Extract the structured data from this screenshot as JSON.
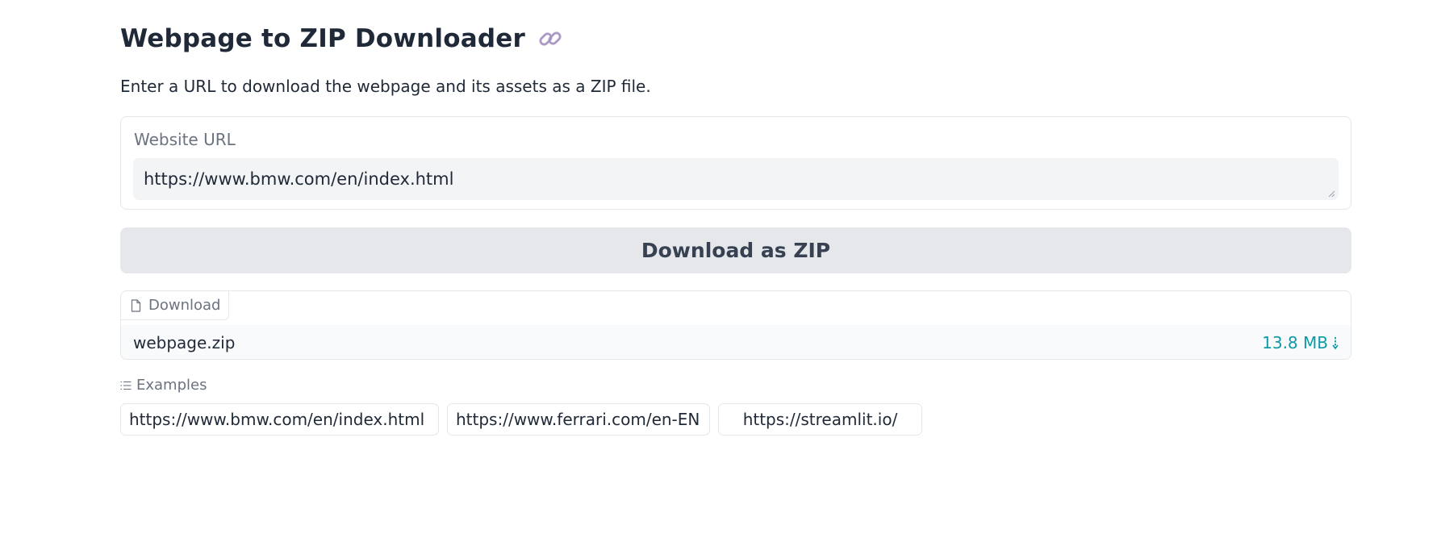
{
  "header": {
    "title": "Webpage to ZIP Downloader",
    "title_icon": "link-icon",
    "description": "Enter a URL to download the webpage and its assets as a ZIP file."
  },
  "url_field": {
    "label": "Website URL",
    "value": "https://www.bmw.com/en/index.html"
  },
  "submit_button": {
    "label": "Download as ZIP"
  },
  "download_output": {
    "tab_label": "Download",
    "tab_icon": "file-icon",
    "file_name": "webpage.zip",
    "file_size": "13.8 MB",
    "download_icon": "download-arrow-icon"
  },
  "examples": {
    "label": "Examples",
    "icon": "list-icon",
    "items": [
      "https://www.bmw.com/en/index.html",
      "https://www.ferrari.com/en-EN",
      "https://streamlit.io/"
    ]
  },
  "colors": {
    "accent": "#0e9aa7",
    "button_bg": "#e5e7eb",
    "input_bg": "#f3f4f6",
    "link_icon": "#c4b5d8"
  }
}
